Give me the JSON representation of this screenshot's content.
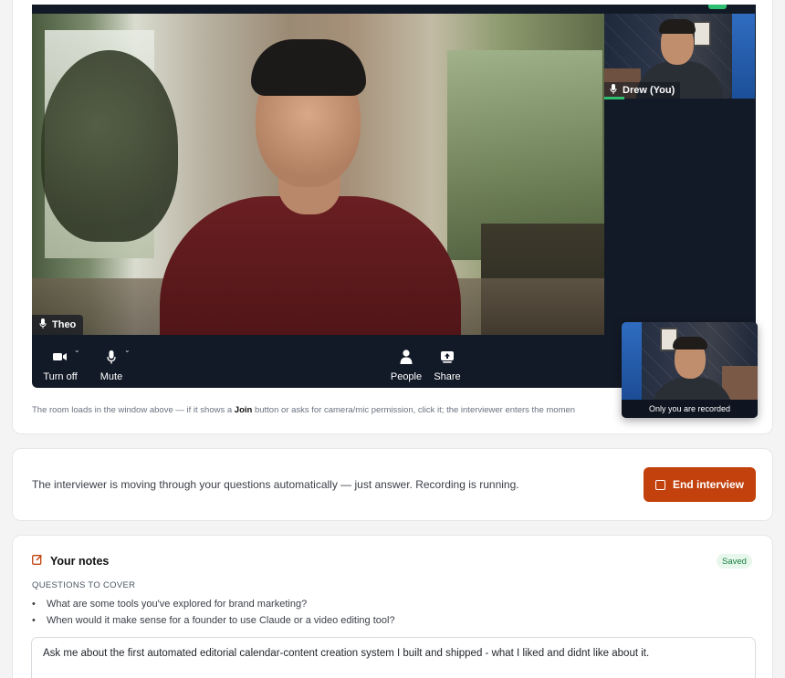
{
  "video": {
    "main_participant_name": "Theo",
    "self_participant_name": "Drew (You)",
    "controls": {
      "camera_label": "Turn off",
      "mute_label": "Mute",
      "people_label": "People",
      "share_label": "Share"
    },
    "room_note_prefix": "The room loads in the window above — if it shows a ",
    "room_note_bold": "Join",
    "room_note_suffix": " button or asks for camera/mic permission, click it; the interviewer enters the momen"
  },
  "recorder_preview": {
    "label": "Only you are recorded"
  },
  "status": {
    "message": "The interviewer is moving through your questions automatically — just answer. Recording is running.",
    "end_button_label": "End interview",
    "accent_color": "#c2410c"
  },
  "notes": {
    "title": "Your notes",
    "saved_badge": "Saved",
    "questions_heading": "QUESTIONS TO COVER",
    "questions": [
      "What are some tools you've explored for brand marketing?",
      "When would it make sense for a founder to use Claude or a video editing tool?"
    ],
    "notes_value": "Ask me about the first automated editorial calendar-content creation system I built and shipped - what I liked and didnt like about it."
  },
  "icons": [
    "mic-icon",
    "camera-icon",
    "chevron-down-icon",
    "person-icon",
    "share-icon",
    "stop-square-icon",
    "edit-note-icon"
  ]
}
